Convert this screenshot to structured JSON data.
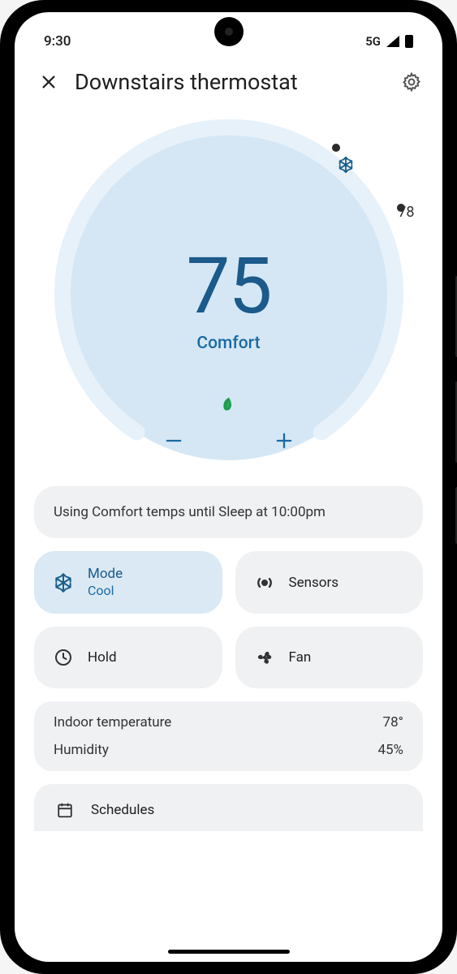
{
  "status_bar": {
    "time": "9:30",
    "network": "5G"
  },
  "header": {
    "title": "Downstairs thermostat"
  },
  "dial": {
    "current_temp": "75",
    "preset_label": "Comfort",
    "target_temp": "78"
  },
  "status_message": "Using Comfort temps until Sleep at 10:00pm",
  "tiles": {
    "mode": {
      "label": "Mode",
      "value": "Cool"
    },
    "sensors": {
      "label": "Sensors"
    },
    "hold": {
      "label": "Hold"
    },
    "fan": {
      "label": "Fan"
    }
  },
  "info": {
    "indoor_temp_label": "Indoor temperature",
    "indoor_temp_value": "78°",
    "humidity_label": "Humidity",
    "humidity_value": "45%"
  },
  "schedules_label": "Schedules"
}
